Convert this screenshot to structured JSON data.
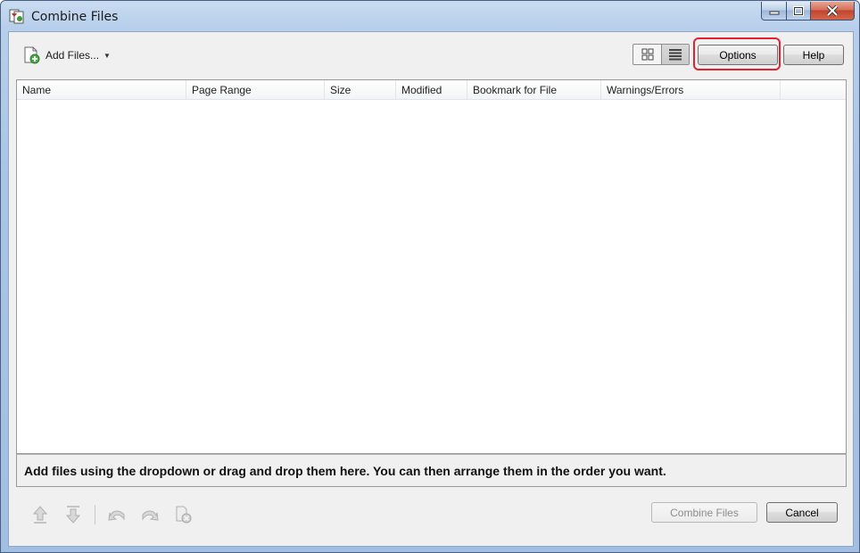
{
  "window": {
    "title": "Combine Files",
    "controls": {
      "minimize_icon": "minimize-icon",
      "maximize_icon": "maximize-icon",
      "close_icon": "close-icon"
    }
  },
  "toolbar": {
    "add_files_label": "Add Files...",
    "add_files_icon": "add-file-icon",
    "view_thumbnails_icon": "thumbnail-view-icon",
    "view_list_icon": "list-view-icon",
    "options_label": "Options",
    "help_label": "Help"
  },
  "file_list": {
    "columns": [
      "Name",
      "Page Range",
      "Size",
      "Modified",
      "Bookmark for File",
      "Warnings/Errors"
    ],
    "rows": []
  },
  "hint": "Add files using the dropdown or drag and drop them here. You can then arrange them in the order you want.",
  "bottom_tools": [
    "move-up-icon",
    "move-down-icon",
    "undo-icon",
    "redo-icon",
    "remove-file-icon"
  ],
  "actions": {
    "combine_label": "Combine Files",
    "cancel_label": "Cancel"
  },
  "colors": {
    "highlight": "#e0232f",
    "frame": "#a9c4e6"
  }
}
